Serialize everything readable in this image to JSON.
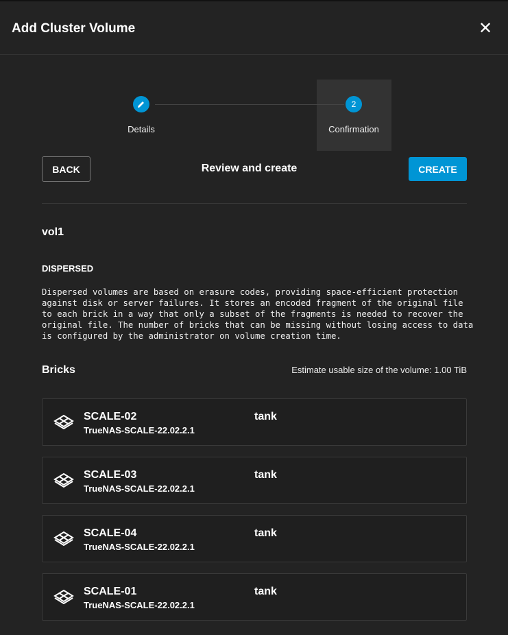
{
  "dialog": {
    "title": "Add Cluster Volume"
  },
  "stepper": {
    "steps": [
      {
        "label": "Details",
        "icon": "pencil-icon"
      },
      {
        "label": "Confirmation",
        "number": "2"
      }
    ]
  },
  "actions": {
    "back": "BACK",
    "heading": "Review and create",
    "create": "CREATE"
  },
  "volume": {
    "name": "vol1",
    "type": "DISPERSED",
    "description": "Dispersed volumes are based on erasure codes, providing space-efficient protection against disk or server failures. It stores an encoded fragment of the original file to each brick in a way that only a subset of the fragments is needed to recover the original file. The number of bricks that can be missing without losing access to data is configured by the administrator on volume creation time."
  },
  "bricks": {
    "title": "Bricks",
    "estimate": "Estimate usable size of the volume: 1.00 TiB",
    "items": [
      {
        "name": "SCALE-02",
        "version": "TrueNAS-SCALE-22.02.2.1",
        "pool": "tank"
      },
      {
        "name": "SCALE-03",
        "version": "TrueNAS-SCALE-22.02.2.1",
        "pool": "tank"
      },
      {
        "name": "SCALE-04",
        "version": "TrueNAS-SCALE-22.02.2.1",
        "pool": "tank"
      },
      {
        "name": "SCALE-01",
        "version": "TrueNAS-SCALE-22.02.2.1",
        "pool": "tank"
      }
    ]
  },
  "colors": {
    "accent": "#0095d5",
    "background": "#232323"
  }
}
